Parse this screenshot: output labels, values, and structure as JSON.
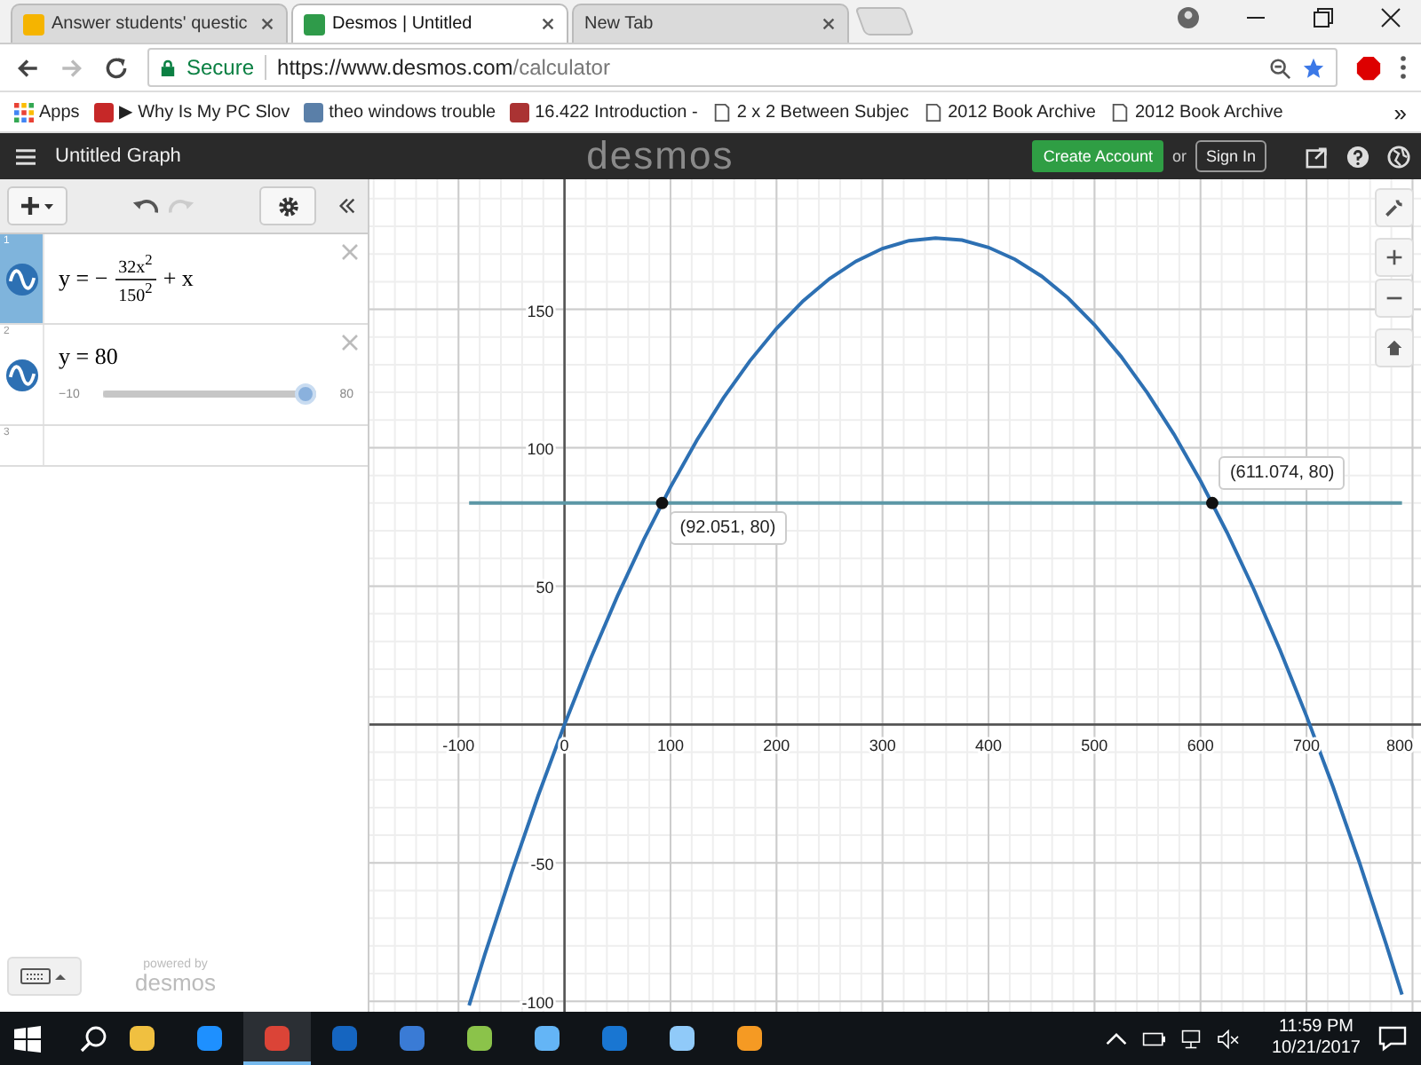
{
  "browser": {
    "tabs": [
      {
        "title": "Answer students' questic",
        "selected": false
      },
      {
        "title": "Desmos | Untitled",
        "selected": true
      },
      {
        "title": "New Tab",
        "selected": false
      }
    ],
    "address": {
      "secure_label": "Secure",
      "url_host": "https://www.desmos.com",
      "url_path": "/calculator"
    },
    "bookmarks": [
      "Apps",
      "▶ Why Is My PC Slov",
      "theo windows trouble",
      "16.422 Introduction -",
      "2 x 2 Between Subjec",
      "2012 Book Archive",
      "2012 Book Archive"
    ],
    "bookmarks_more": "»"
  },
  "header": {
    "title": "Untitled Graph",
    "logo": "desmos",
    "create_account": "Create Account",
    "or": "or",
    "sign_in": "Sign In"
  },
  "expressions": [
    {
      "number": "1",
      "kind": "fraction",
      "selected": true,
      "prefix": "y = −",
      "numerator": "32x$^{2}$",
      "denominator": "150$^{2}$",
      "suffix": "+ x"
    },
    {
      "number": "2",
      "kind": "slider",
      "selected": false,
      "text": "y = 80",
      "min": "−10",
      "max": "80",
      "level": 1
    },
    {
      "number": "3",
      "kind": "empty",
      "selected": false
    }
  ],
  "footer": {
    "powered_by": "powered by",
    "logo": "desmos"
  },
  "graph": {
    "chart_data": {
      "type": "line",
      "grid": true,
      "xlim": [
        -184,
        808
      ],
      "ylim": [
        -107,
        197
      ],
      "xticks": [
        -100,
        0,
        100,
        200,
        300,
        400,
        500,
        600,
        700,
        800
      ],
      "yticks": [
        -100,
        -50,
        50,
        100,
        150
      ],
      "x": [
        -90,
        -75,
        -50,
        -25,
        0,
        25,
        50,
        75,
        100,
        125,
        150,
        175,
        200,
        225,
        250,
        275,
        300,
        325,
        350,
        375,
        400,
        425,
        450,
        475,
        500,
        525,
        550,
        575,
        600,
        625,
        650,
        675,
        700,
        725,
        750,
        775,
        790
      ],
      "series": [
        {
          "color": "#2d70b3",
          "values": [
            -101.5,
            -83,
            -53.6,
            -25.9,
            0,
            24.1,
            46.4,
            67,
            85.8,
            102.8,
            118,
            131.4,
            143.1,
            153,
            161.1,
            167.4,
            172,
            174.8,
            175.8,
            175,
            172.4,
            168.1,
            162,
            154.1,
            144.4,
            133,
            119.8,
            104.8,
            88,
            69.4,
            49.1,
            27,
            3.1,
            -22.6,
            -50,
            -79.2,
            -97.6
          ]
        },
        {
          "color": "#5c97a6",
          "values": [
            80,
            80,
            80,
            80,
            80,
            80,
            80,
            80,
            80,
            80,
            80,
            80,
            80,
            80,
            80,
            80,
            80,
            80,
            80,
            80,
            80,
            80,
            80,
            80,
            80,
            80,
            80,
            80,
            80,
            80,
            80,
            80,
            80,
            80,
            80,
            80,
            80
          ]
        }
      ],
      "annotations": [
        {
          "x": 92.051,
          "y": 80,
          "text": "(92.051, 80)"
        },
        {
          "x": 611.074,
          "y": 80,
          "text": "(611.074, 80)"
        }
      ]
    }
  },
  "taskbar": {
    "time": "11:59 PM",
    "date": "10/21/2017"
  }
}
